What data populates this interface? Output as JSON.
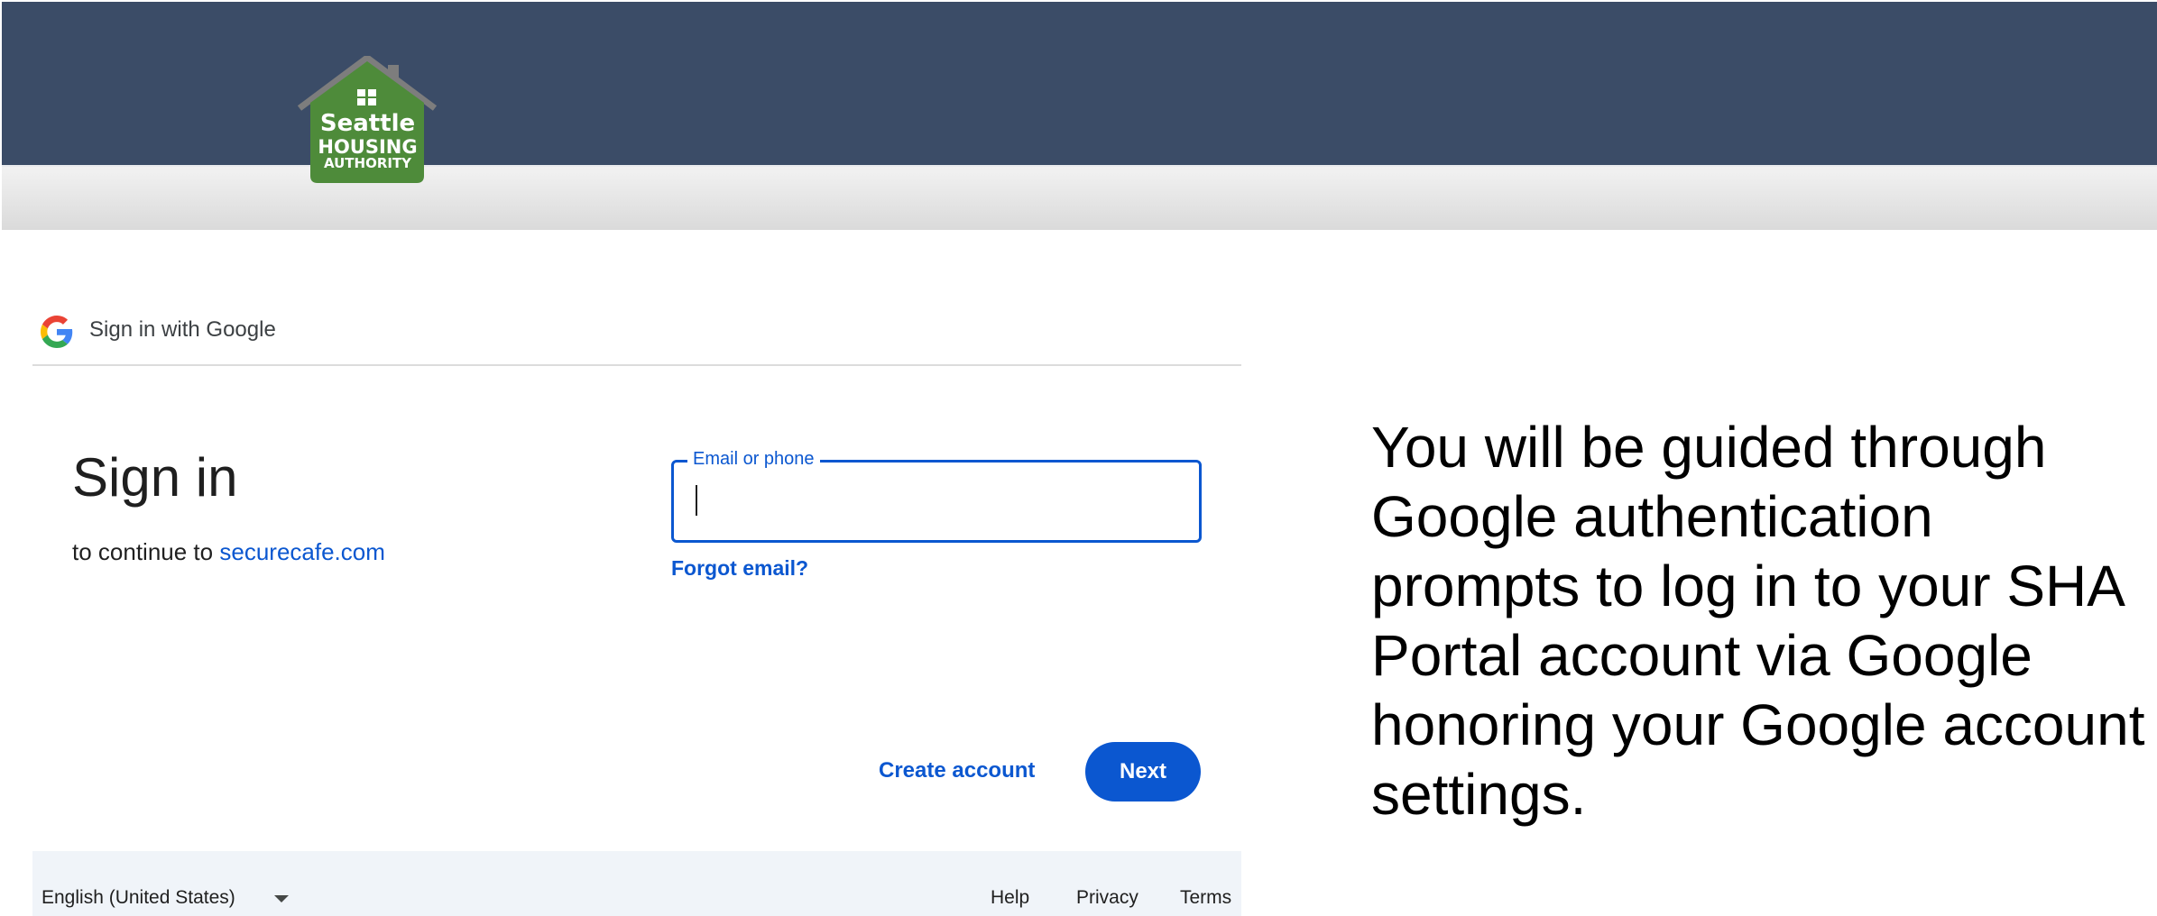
{
  "brand": {
    "logo_line1": "Seattle",
    "logo_line2": "HOUSING",
    "logo_line3": "AUTHORITY",
    "header_color": "#3b4c67",
    "logo_color": "#4e8b3a"
  },
  "google_signin": {
    "topbar_label": "Sign in with Google",
    "title": "Sign in",
    "continue_prefix": "to continue to",
    "continue_domain": "securecafe.com",
    "email_label": "Email or phone",
    "email_value": "",
    "forgot_email": "Forgot email?",
    "create_account": "Create account",
    "next": "Next",
    "accent_color": "#0b57d0"
  },
  "footer": {
    "language": "English (United States)",
    "help": "Help",
    "privacy": "Privacy",
    "terms": "Terms"
  },
  "caption": "You will be guided through Google authentication prompts to log in to your SHA Portal account via Google honoring your Google account settings."
}
